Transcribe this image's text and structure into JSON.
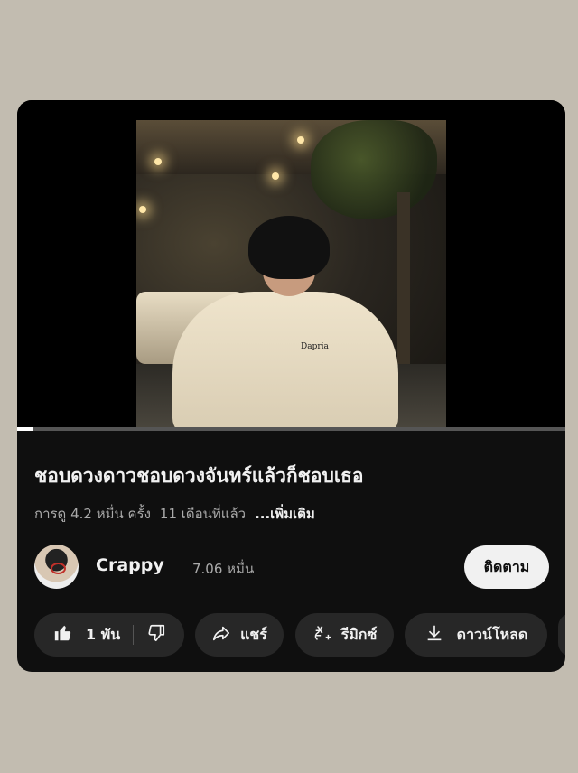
{
  "video": {
    "title": "ชอบดวงดาวชอบดวงจันทร์แล้วก็ชอบเธอ",
    "views": "การดู 4.2 หมื่น ครั้ง",
    "age": "11 เดือนที่แล้ว",
    "more": "...เพิ่มเติม",
    "progress_fraction": 0.03,
    "shirt_logo": "Dapria"
  },
  "channel": {
    "name": "Crappy",
    "subscribers": "7.06 หมื่น",
    "subscribe_label": "ติดตาม"
  },
  "actions": {
    "like_count": "1 พัน",
    "share_label": "แชร์",
    "remix_label": "รีมิกซ์",
    "download_label": "ดาวน์โหลด"
  },
  "icons": [
    "thumbs-up-icon",
    "thumbs-down-icon",
    "share-icon",
    "remix-icon",
    "download-icon"
  ]
}
